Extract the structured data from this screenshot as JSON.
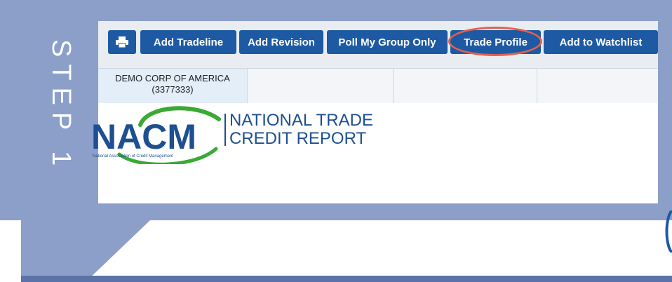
{
  "step": {
    "label": "STEP 1"
  },
  "toolbar": {
    "print_icon": "printer-icon",
    "buttons": [
      "Add Tradeline",
      "Add Revision",
      "Poll My Group Only",
      "Trade Profile",
      "Add to Watchlist"
    ],
    "highlighted": "Trade Profile"
  },
  "grid": {
    "company_name": "DEMO CORP OF AMERICA",
    "company_id": "(3377333)"
  },
  "report": {
    "logo_text": "NACM",
    "logo_subtext": "National Association of Credit Management",
    "title_line1": "NATIONAL TRADE",
    "title_line2": "CREDIT REPORT"
  },
  "colors": {
    "frame": "#8b9fc9",
    "button": "#1d5aa3",
    "highlight": "#e2604f",
    "logo_blue": "#1d4f91",
    "logo_green": "#3aa935"
  }
}
